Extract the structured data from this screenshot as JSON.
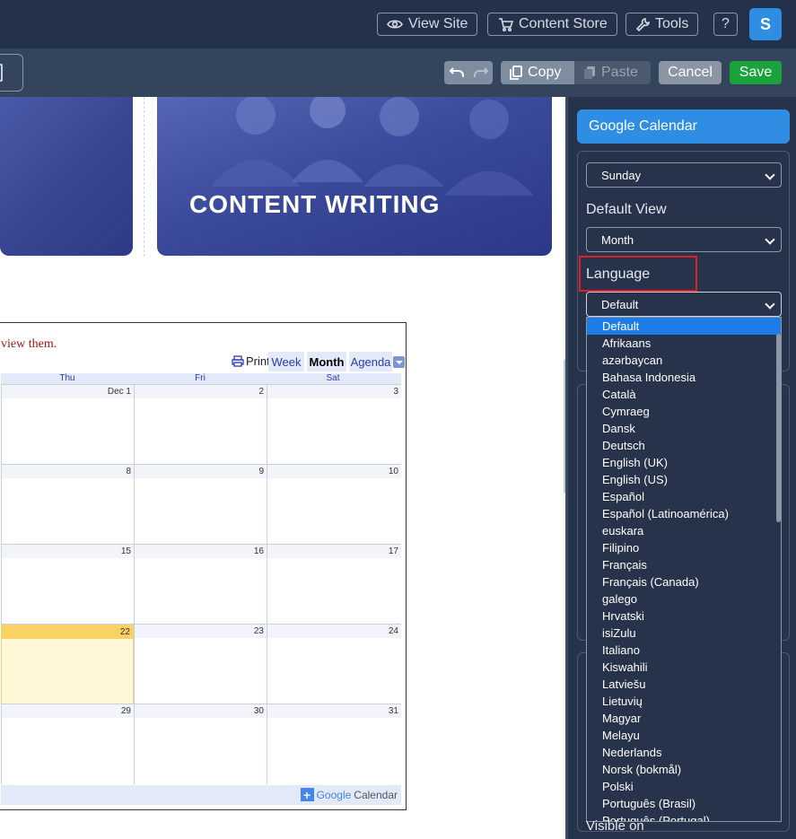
{
  "topbar": {
    "view_site": "View Site",
    "content_store": "Content Store",
    "tools": "Tools",
    "help": "?",
    "avatar_initial": "S"
  },
  "toolbar": {
    "copy": "Copy",
    "paste": "Paste",
    "cancel": "Cancel",
    "save": "Save",
    "colors": {
      "save": "#19a33a",
      "cancel": "#8a96a4",
      "accent": "#2f8de4"
    }
  },
  "preview": {
    "card_title": "CONTENT WRITING",
    "calendar": {
      "message": "view them.",
      "print": "Print",
      "tabs": {
        "week": "Week",
        "month": "Month",
        "agenda": "Agenda"
      },
      "active_tab": "Month",
      "day_headers": [
        "Thu",
        "Fri",
        "Sat"
      ],
      "weeks": [
        [
          "Dec 1",
          "2",
          "3"
        ],
        [
          "8",
          "9",
          "10"
        ],
        [
          "15",
          "16",
          "17"
        ],
        [
          "22",
          "23",
          "24"
        ],
        [
          "29",
          "30",
          "31"
        ]
      ],
      "today": "22",
      "footer_brand": {
        "plus": "+",
        "google": "Google",
        "calendar": "Calendar"
      }
    }
  },
  "panel": {
    "title": "Google Calendar",
    "week_start_value": "Sunday",
    "default_view_label": "Default View",
    "default_view_value": "Month",
    "language_label": "Language",
    "language_value": "Default",
    "language_options": [
      "Default",
      "Afrikaans",
      "azərbaycan",
      "Bahasa Indonesia",
      "Català",
      "Cymraeg",
      "Dansk",
      "Deutsch",
      "English (UK)",
      "English (US)",
      "Español",
      "Español (Latinoamérica)",
      "euskara",
      "Filipino",
      "Français",
      "Français (Canada)",
      "galego",
      "Hrvatski",
      "isiZulu",
      "Italiano",
      "Kiswahili",
      "Latviešu",
      "Lietuvių",
      "Magyar",
      "Melayu",
      "Nederlands",
      "Norsk (bokmål)",
      "Polski",
      "Português (Brasil)",
      "Português (Portugal)"
    ],
    "visible_on_label": "Visible on"
  }
}
